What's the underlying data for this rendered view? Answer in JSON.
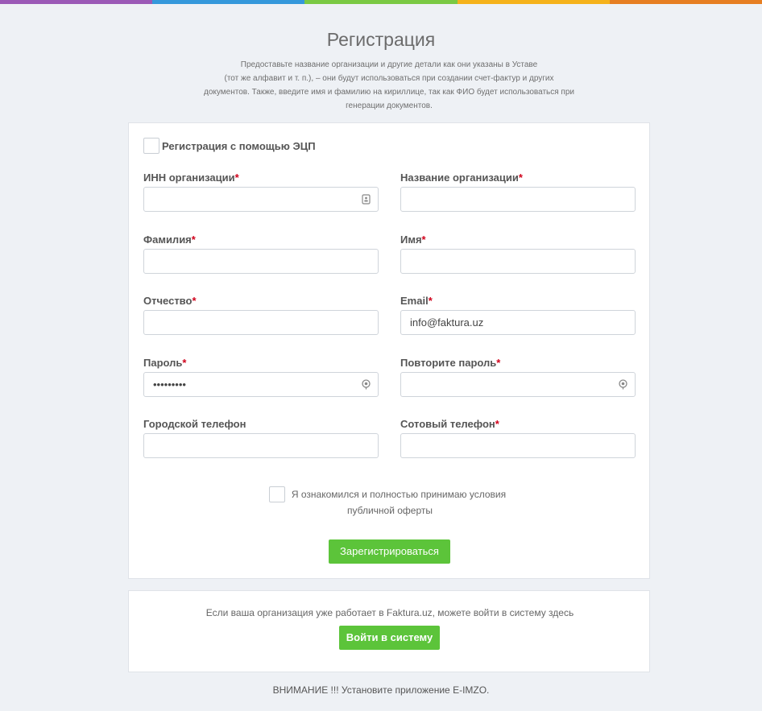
{
  "colors": {
    "top_bar": [
      "#9b59b6",
      "#3498db",
      "#7ac943",
      "#f5b21b",
      "#e67e22"
    ],
    "accent_button": "#5cc43a",
    "required_mark": "#d0021b"
  },
  "header": {
    "title": "Регистрация",
    "subtitle_lines": [
      "Предоставьте название организации и другие детали как они указаны в Уставе",
      "(тот же алфавит и т. п.), – они будут использоваться при создании счет-фактур и других",
      "документов. Также, введите имя и фамилию на кириллице, так как ФИО будет использоваться при",
      "генерации документов."
    ]
  },
  "form": {
    "eds_checkbox_label": "Регистрация с помощью ЭЦП",
    "required_mark": "*",
    "fields": {
      "inn": {
        "label": "ИНН организации",
        "value": "",
        "icon": "id-card-icon"
      },
      "org_name": {
        "label": "Название организации",
        "value": ""
      },
      "last_name": {
        "label": "Фамилия",
        "value": ""
      },
      "first_name": {
        "label": "Имя",
        "value": ""
      },
      "patronymic": {
        "label": "Отчество",
        "value": ""
      },
      "email": {
        "label": "Email",
        "value": "info@faktura.uz"
      },
      "password": {
        "label": "Пароль",
        "value": "•••••••••",
        "icon": "eye-icon"
      },
      "password_repeat": {
        "label": "Повторите пароль",
        "value": "",
        "icon": "eye-icon"
      },
      "city_phone": {
        "label": "Городской телефон",
        "value": ""
      },
      "mobile_phone": {
        "label": "Сотовый телефон",
        "value": ""
      }
    },
    "terms_line1": "Я ознакомился и полностью принимаю условия",
    "terms_line2": "публичной оферты",
    "submit_label": "Зарегистрироваться"
  },
  "login": {
    "text": "Если ваша организация уже работает в Faktura.uz, можете войти в систему здесь",
    "button_label": "Войти в систему"
  },
  "footer": {
    "warning": "ВНИМАНИЕ !!! Установите приложение E-IMZO."
  }
}
